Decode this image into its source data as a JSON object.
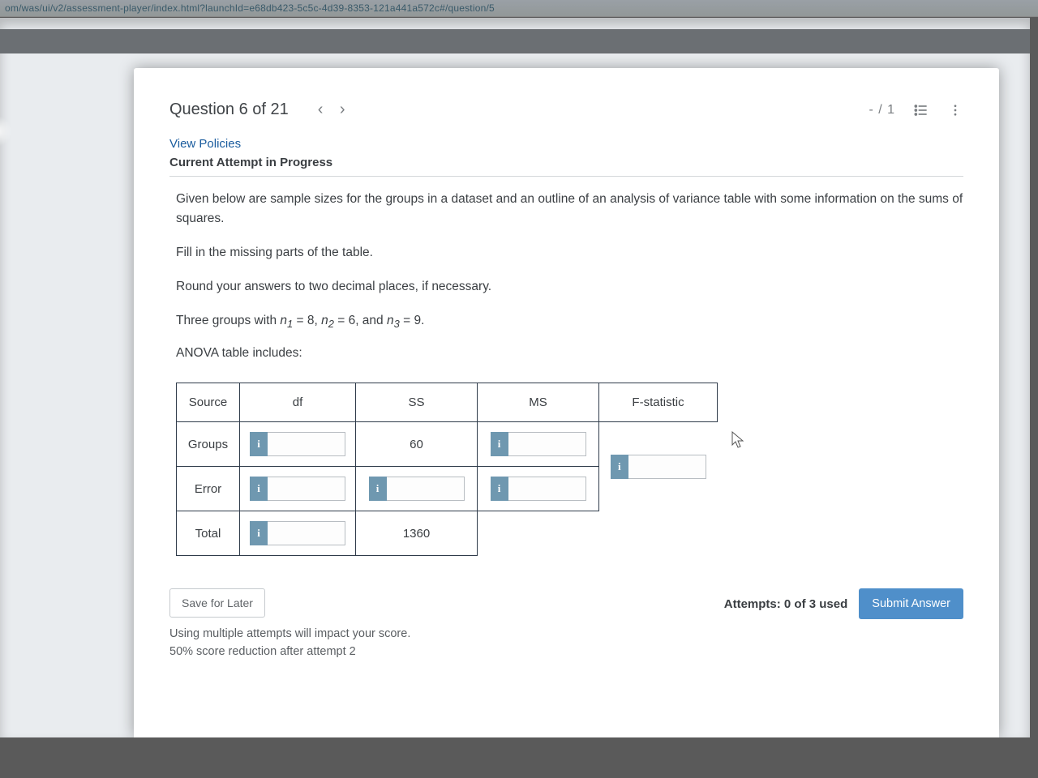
{
  "url": "om/was/ui/v2/assessment-player/index.html?launchId=e68db423-5c5c-4d39-8353-121a441a572c#/question/5",
  "header": {
    "title": "Question 6 of 21",
    "score": "- / 1"
  },
  "links": {
    "policies": "View Policies"
  },
  "status": "Current Attempt in Progress",
  "body": {
    "p1": "Given below are sample sizes for the groups in a dataset and an outline of an analysis of variance table with some information on the sums of squares.",
    "p2": "Fill in the missing parts of the table.",
    "p3": "Round your answers to two decimal places, if necessary.",
    "p4_pre": "Three groups with ",
    "p4_mid1": " = 8, ",
    "p4_mid2": " = 6, and ",
    "p4_post": " = 9.",
    "p5": "ANOVA table includes:"
  },
  "table": {
    "head": {
      "source": "Source",
      "df": "df",
      "ss": "SS",
      "ms": "MS",
      "f": "F-statistic"
    },
    "rows": {
      "groups": {
        "label": "Groups",
        "ss": "60"
      },
      "error": {
        "label": "Error"
      },
      "total": {
        "label": "Total",
        "ss": "1360"
      }
    }
  },
  "footer": {
    "save": "Save for Later",
    "note1": "Using multiple attempts will impact your score.",
    "note2": "50% score reduction after attempt 2",
    "attempts": "Attempts: 0 of 3 used",
    "submit": "Submit Answer"
  }
}
